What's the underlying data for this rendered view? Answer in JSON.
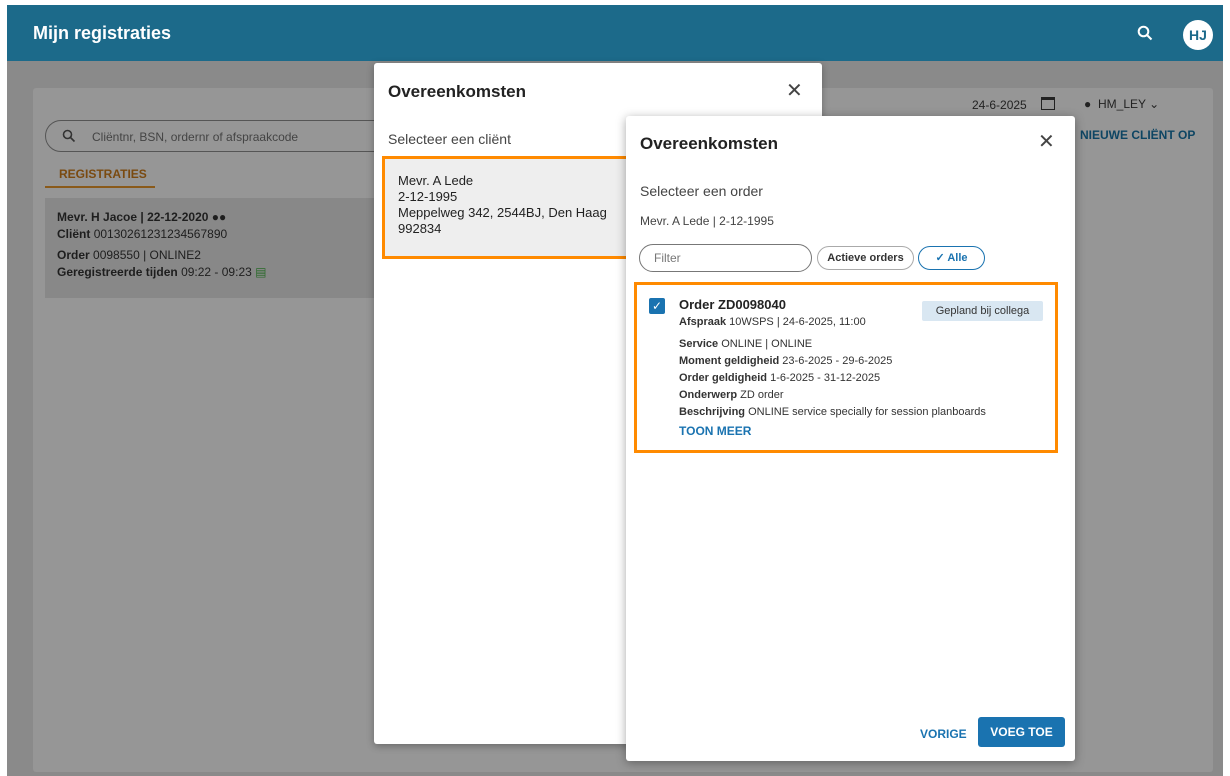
{
  "appbar": {
    "title": "Mijn registraties",
    "avatar_initials": "HJ"
  },
  "background": {
    "search_placeholder": "Cliëntnr, BSN, ordernr of afspraakcode",
    "tab_label": "REGISTRATIES",
    "date": "24-6-2025",
    "location": "HM_LEY",
    "new_client_label": "NIEUWE CLIËNT OP",
    "registration": {
      "name": "Mevr. H Jacoe | 22-12-2020",
      "client_label": "Cliënt",
      "client_value": "00130261231234567890",
      "order_label": "Order",
      "order_value": "0098550 | ONLINE2",
      "times_label": "Geregistreerde tijden",
      "times_value": "09:22 - 09:23"
    }
  },
  "dialog_client": {
    "title": "Overeenkomsten",
    "subtitle": "Selecteer een cliënt",
    "client": {
      "name": "Mevr. A Lede",
      "dob": "2-12-1995",
      "address": "Meppelweg 342, 2544BJ, Den Haag",
      "number": "992834"
    }
  },
  "dialog_order": {
    "title": "Overeenkomsten",
    "subtitle": "Selecteer een order",
    "client_line": "Mevr. A Lede | 2-12-1995",
    "filter_placeholder": "Filter",
    "chip_active": "Actieve orders",
    "chip_all": "Alle",
    "order": {
      "title": "Order ZD0098040",
      "badge": "Gepland bij collega",
      "appointment_label": "Afspraak",
      "appointment_value": "10WSPS | 24-6-2025, 11:00",
      "service_label": "Service",
      "service_value": "ONLINE | ONLINE",
      "moment_label": "Moment geldigheid",
      "moment_value": "23-6-2025 - 29-6-2025",
      "order_validity_label": "Order geldigheid",
      "order_validity_value": "1-6-2025 - 31-12-2025",
      "subject_label": "Onderwerp",
      "subject_value": "ZD order",
      "description_label": "Beschrijving",
      "description_value": "ONLINE service specially for session planboards",
      "more_label": "TOON MEER"
    },
    "prev_label": "VORIGE",
    "add_label": "VOEG TOE"
  }
}
